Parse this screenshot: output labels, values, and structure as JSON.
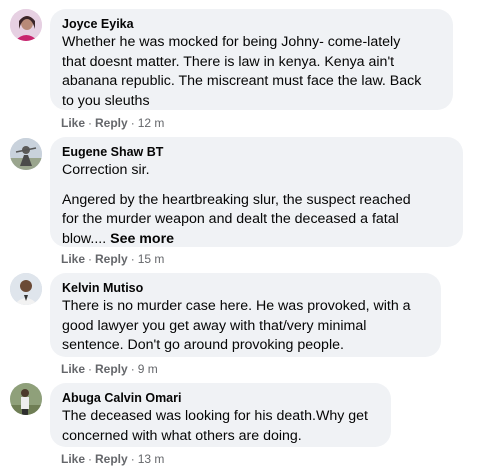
{
  "comments": [
    {
      "author": "Joyce Eyika",
      "lines": [
        "Whether he was mocked for being Johny- come-lately",
        "that doesnt matter. There is law in kenya. Kenya ain't",
        "abanana republic. The miscreant must face the law. Back",
        "to you sleuths"
      ],
      "like": "Like",
      "reply": "Reply",
      "time": "12 m"
    },
    {
      "author": "Eugene Shaw BT",
      "first_line": "Correction sir.",
      "lines": [
        "Angered by the heartbreaking slur, the suspect reached",
        "for the murder weapon and dealt the deceased a fatal"
      ],
      "last_line": "blow....",
      "see_more": "See more",
      "like": "Like",
      "reply": "Reply",
      "time": "15 m"
    },
    {
      "author": "Kelvin Mutiso",
      "lines": [
        "There is no murder case here. He was provoked, with a",
        "good lawyer you get away with that/very minimal",
        "sentence. Don't go around provoking people."
      ],
      "like": "Like",
      "reply": "Reply",
      "time": "9 m"
    },
    {
      "author": "Abuga Calvin Omari",
      "lines": [
        "The deceased was looking for his death.Why get",
        "concerned with what others are doing."
      ],
      "like": "Like",
      "reply": "Reply",
      "time": "13 m"
    }
  ],
  "separator": "·"
}
